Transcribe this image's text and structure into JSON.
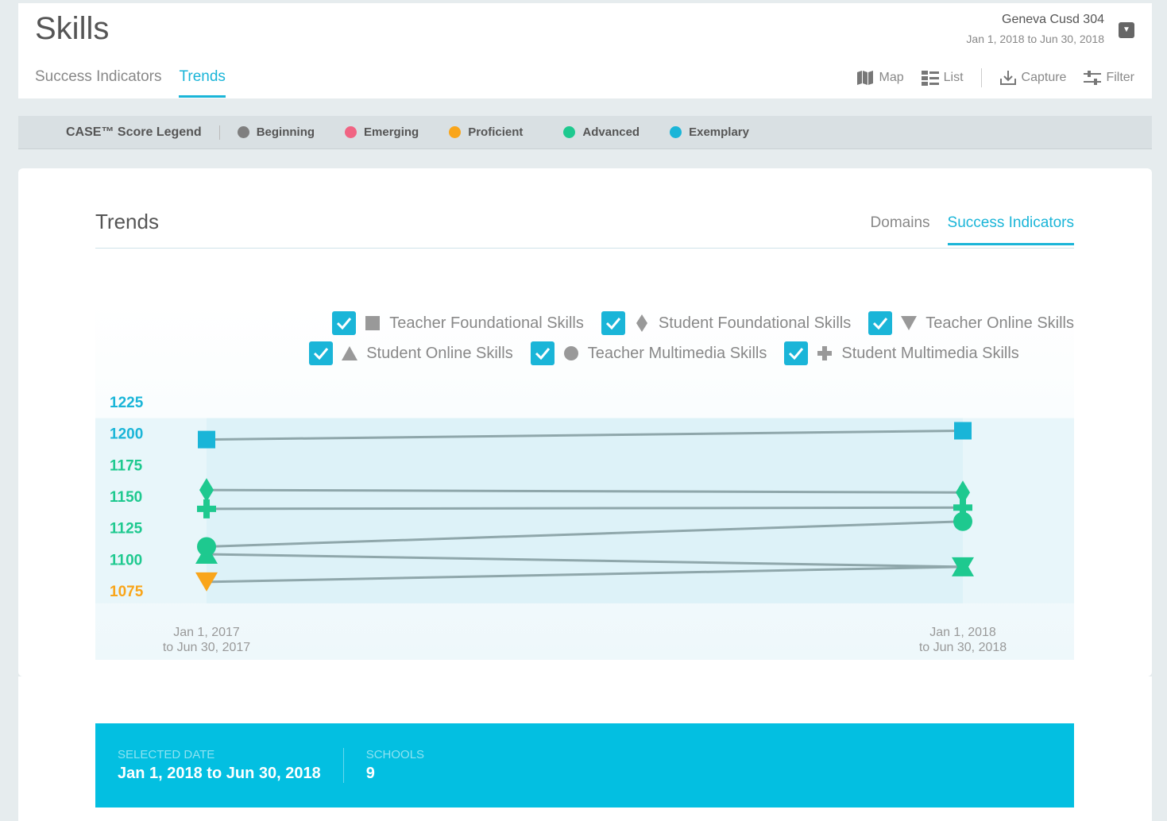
{
  "header": {
    "title": "Skills",
    "district_name": "Geneva Cusd 304",
    "district_dates": "Jan 1, 2018 to Jun 30, 2018",
    "tabs": [
      {
        "label": "Success Indicators",
        "active": false
      },
      {
        "label": "Trends",
        "active": true
      }
    ],
    "toolbar": {
      "map": "Map",
      "list": "List",
      "capture": "Capture",
      "filter": "Filter"
    }
  },
  "legend": {
    "title": "CASE™ Score Legend",
    "items": [
      {
        "label": "Beginning",
        "color": "#7f7f7f"
      },
      {
        "label": "Emerging",
        "color": "#f06483"
      },
      {
        "label": "Proficient",
        "color": "#f9a51a"
      },
      {
        "label": "Advanced",
        "color": "#1ec98f"
      },
      {
        "label": "Exemplary",
        "color": "#1ab5d8"
      }
    ]
  },
  "trends": {
    "title": "Trends",
    "sub_tabs": [
      {
        "label": "Domains",
        "active": false
      },
      {
        "label": "Success Indicators",
        "active": true
      }
    ]
  },
  "chart_data": {
    "type": "line",
    "categories": [
      "Jan 1, 2017\nto Jun 30, 2017",
      "Jan 1, 2018\nto Jun 30, 2018"
    ],
    "x_labels": [
      {
        "line1": "Jan 1, 2017",
        "line2": "to Jun 30, 2017"
      },
      {
        "line1": "Jan 1, 2018",
        "line2": "to Jun 30, 2018"
      }
    ],
    "ylim": [
      1070,
      1225
    ],
    "y_ticks": [
      {
        "value": 1225,
        "color": "#1ab5d8"
      },
      {
        "value": 1200,
        "color": "#1ab5d8"
      },
      {
        "value": 1175,
        "color": "#1ec98f"
      },
      {
        "value": 1150,
        "color": "#1ec98f"
      },
      {
        "value": 1125,
        "color": "#1ec98f"
      },
      {
        "value": 1100,
        "color": "#1ec98f"
      },
      {
        "value": 1075,
        "color": "#f9a51a"
      }
    ],
    "series": [
      {
        "name": "Teacher Foundational Skills",
        "shape": "square",
        "checked": true,
        "values": [
          1195,
          1202
        ],
        "colors": [
          "#1ab5d8",
          "#1ab5d8"
        ]
      },
      {
        "name": "Student Foundational Skills",
        "shape": "diamond",
        "checked": true,
        "values": [
          1155,
          1153
        ],
        "colors": [
          "#1ec98f",
          "#1ec98f"
        ]
      },
      {
        "name": "Teacher Online Skills",
        "shape": "triangle-down",
        "checked": true,
        "values": [
          1082,
          1094
        ],
        "colors": [
          "#f9a51a",
          "#1ec98f"
        ]
      },
      {
        "name": "Student Online Skills",
        "shape": "triangle-up",
        "checked": true,
        "values": [
          1104,
          1094
        ],
        "colors": [
          "#1ec98f",
          "#1ec98f"
        ]
      },
      {
        "name": "Teacher Multimedia Skills",
        "shape": "circle",
        "checked": true,
        "values": [
          1110,
          1130
        ],
        "colors": [
          "#1ec98f",
          "#1ec98f"
        ]
      },
      {
        "name": "Student Multimedia Skills",
        "shape": "plus",
        "checked": true,
        "values": [
          1140,
          1141
        ],
        "colors": [
          "#1ec98f",
          "#1ec98f"
        ]
      }
    ]
  },
  "info_bar": {
    "selected_date_label": "SELECTED DATE",
    "selected_date_value": "Jan 1, 2018 to Jun 30, 2018",
    "schools_label": "SCHOOLS",
    "schools_value": "9"
  }
}
